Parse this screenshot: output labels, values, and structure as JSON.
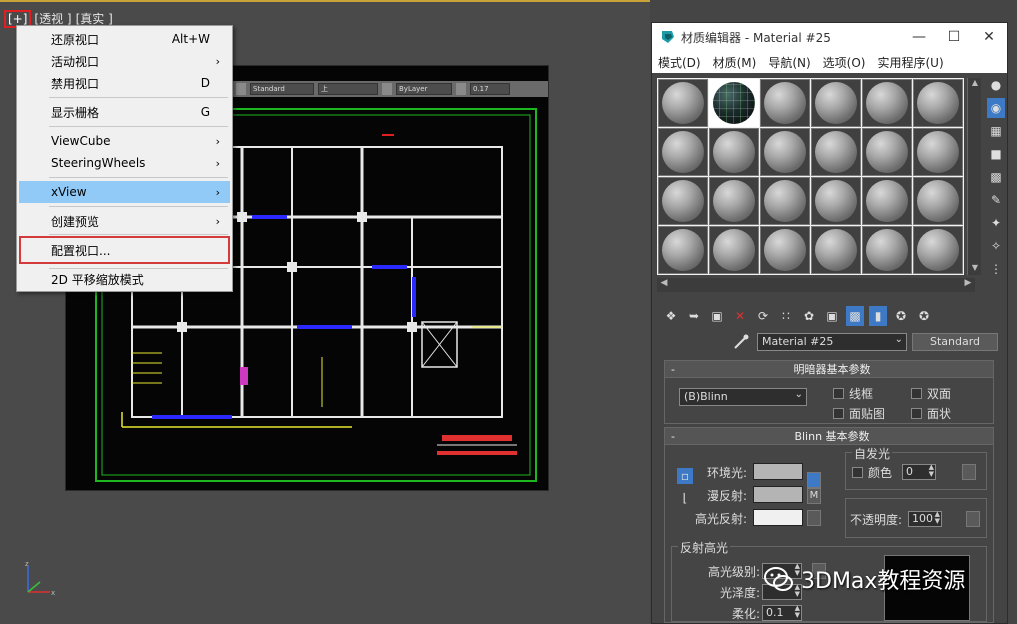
{
  "viewport": {
    "label_plus": "[+]",
    "label_view": "[透视 ]",
    "label_shading": "[真实 ]",
    "cad_toolbar": {
      "field1": "Standard",
      "field2": "上",
      "field3": "ByLayer",
      "field4": "0.17"
    }
  },
  "context_menu": {
    "items": [
      {
        "label": "还原视口",
        "shortcut": "Alt+W",
        "arrow": ""
      },
      {
        "label": "活动视口",
        "shortcut": "",
        "arrow": "›"
      },
      {
        "label": "禁用视口",
        "shortcut": "D",
        "arrow": ""
      },
      {
        "label": "显示栅格",
        "shortcut": "G",
        "arrow": ""
      },
      {
        "label": "ViewCube",
        "shortcut": "",
        "arrow": "›"
      },
      {
        "label": "SteeringWheels",
        "shortcut": "",
        "arrow": "›"
      },
      {
        "label": "xView",
        "shortcut": "",
        "arrow": "›"
      },
      {
        "label": "创建预览",
        "shortcut": "",
        "arrow": "›"
      },
      {
        "label": "配置视口...",
        "shortcut": "",
        "arrow": ""
      },
      {
        "label": "2D 平移缩放模式",
        "shortcut": "",
        "arrow": ""
      }
    ]
  },
  "material_editor": {
    "title": "材质编辑器 - Material #25",
    "menu": [
      "模式(D)",
      "材质(M)",
      "导航(N)",
      "选项(O)",
      "实用程序(U)"
    ],
    "material_name": "Material #25",
    "material_type": "Standard",
    "shader_rollout": {
      "title": "明暗器基本参数",
      "shader": "(B)Blinn",
      "wire": "线框",
      "two_sided": "双面",
      "face_map": "面贴图",
      "faceted": "面状"
    },
    "blinn_rollout": {
      "title": "Blinn 基本参数",
      "self_illum_title": "自发光",
      "color_label": "颜色",
      "color_value": "0",
      "ambient": "环境光:",
      "diffuse": "漫反射:",
      "specular": "高光反射:",
      "lock_m": "M",
      "opacity_label": "不透明度:",
      "opacity_value": "100",
      "spec_highlights_title": "反射高光",
      "spec_level": "高光级别:",
      "glossiness": "光泽度:",
      "soften": "柔化:",
      "soften_value": "0.1"
    }
  },
  "watermark": "3DMax教程资源",
  "colors": {
    "menu_highlight": "#91c9f7",
    "annotation_red": "#d43a3a",
    "active_tool": "#3d79c4",
    "cad_background": "#050505"
  }
}
